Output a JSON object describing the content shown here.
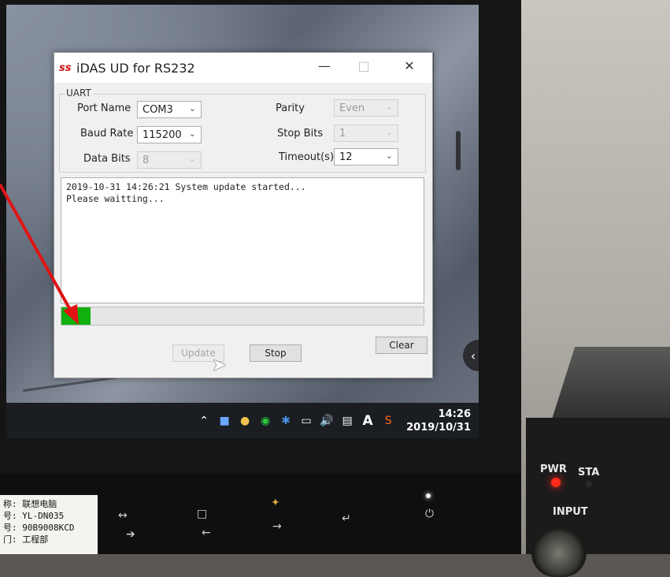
{
  "window": {
    "title": "iDAS UD for RS232",
    "app_icon": "ss"
  },
  "uart": {
    "legend": "UART",
    "port_name_label": "Port Name",
    "port_name_value": "COM3",
    "baud_rate_label": "Baud Rate",
    "baud_rate_value": "115200",
    "data_bits_label": "Data Bits",
    "data_bits_value": "8",
    "parity_label": "Parity",
    "parity_value": "Even",
    "stop_bits_label": "Stop Bits",
    "stop_bits_value": "1",
    "timeout_label": "Timeout(s)",
    "timeout_value": "12"
  },
  "log": {
    "line1": "2019-10-31 14:26:21 System update started...",
    "line2": "Please waitting..."
  },
  "progress": {
    "fraction": 0.08,
    "color": "#10b010"
  },
  "buttons": {
    "update": "Update",
    "stop": "Stop",
    "clear": "Clear"
  },
  "taskbar": {
    "time": "14:26",
    "date": "2019/10/31",
    "ime": "A"
  },
  "sticker": {
    "line1": "称: 联想电脑",
    "line2": "号: YL-DN035",
    "line3": "号: 90B9008KCD",
    "line4": "门: 工程部"
  },
  "device": {
    "pwr": "PWR",
    "sta": "STA",
    "input": "INPUT"
  },
  "colors": {
    "arrow": "#e01414",
    "pwr_led": "#ff2a1a"
  }
}
